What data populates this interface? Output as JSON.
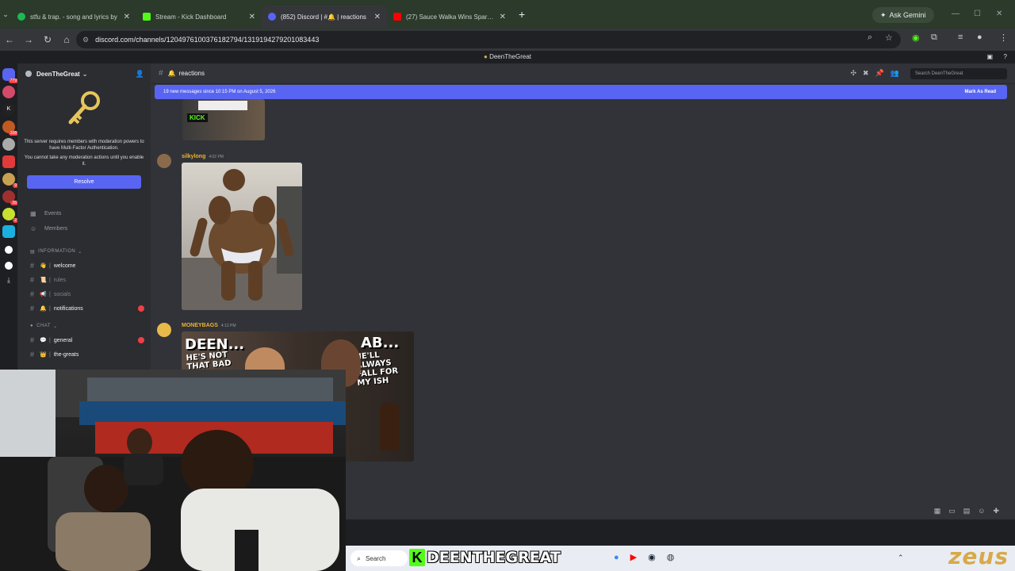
{
  "browser": {
    "tabs": [
      {
        "title": "stfu & trap. - song and lyrics by",
        "color": "#1db954"
      },
      {
        "title": "Stream - Kick Dashboard",
        "color": "#53fc18"
      },
      {
        "title": "(852) Discord | #🔔 | reactions",
        "color": "#5865f2"
      },
      {
        "title": "(27) Sauce Walka Wins Sparring",
        "color": "#ff0000"
      }
    ],
    "new_tab": "+",
    "gemini": "Ask Gemini",
    "url": "discord.com/channels/1204976100376182794/1319194279201083443"
  },
  "discord": {
    "window_title": "DeenTheGreat",
    "server_name": "DeenTheGreat",
    "mfa": {
      "text1": "This server requires members with moderation powers to have Multi-Factor Authentication.",
      "text2": "You cannot take any moderation actions until you enable it.",
      "button": "Resolve"
    },
    "nav": [
      {
        "label": "Events",
        "icon": "📅"
      },
      {
        "label": "Members",
        "icon": "👥"
      }
    ],
    "categories": {
      "info": "INFORMATION",
      "chat": "CHAT"
    },
    "info_channels": [
      {
        "name": "welcome",
        "emoji": "👋",
        "bright": true
      },
      {
        "name": "rules",
        "emoji": "📜",
        "bright": false
      },
      {
        "name": "socials",
        "emoji": "📢",
        "bright": false
      },
      {
        "name": "notifications",
        "emoji": "🔔",
        "bright": true
      }
    ],
    "chat_channels": [
      {
        "name": "general",
        "emoji": "💬",
        "bright": true
      },
      {
        "name": "the-greats",
        "emoji": "👑",
        "bright": true
      }
    ],
    "channel": {
      "name": "reactions",
      "search_placeholder": "Search DeenTheGreat"
    },
    "new_messages": {
      "text": "19 new messages since 10:15 PM on August 5, 2026",
      "action": "Mark As Read"
    },
    "messages": [
      {
        "author": "silkylong",
        "time": "4:02 PM",
        "color": "#f0b232"
      },
      {
        "author": "MONEYBAGS",
        "time": "4:12 PM",
        "color": "#f0b232"
      }
    ],
    "meme": {
      "top_left": "DEEN...",
      "sub_left": "HE'S NOT THAT BAD",
      "top_right": "AB...",
      "sub_right": "HE'LL ALWAYS FALL FOR MY ISH"
    },
    "kick_label": "KICK"
  },
  "taskbar": {
    "search": "Search",
    "streamer": "DEENTHEGREAT",
    "kick_letter": "K",
    "brand": "zeus"
  }
}
